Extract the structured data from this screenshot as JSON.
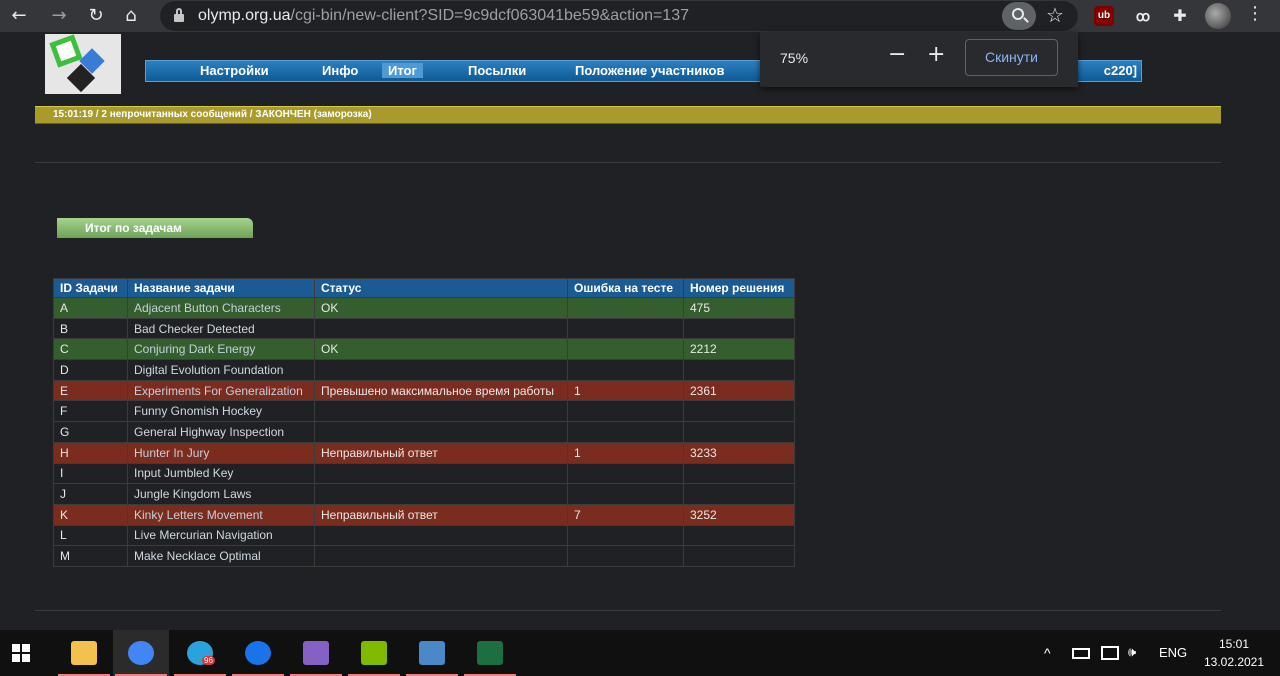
{
  "browser": {
    "url_host": "olymp.org.ua",
    "url_path": "/cgi-bin/new-client?SID=9c9dcf063041be59&action=137",
    "back_icon": "←",
    "forward_icon": "→",
    "reload_icon": "↻",
    "home_icon": "⌂",
    "star_icon": "☆",
    "puzzle_icon": "✚",
    "menu_icon": "⋮",
    "ext_ub": "ub",
    "ext_spy": "ꝏ"
  },
  "zoom_popup": {
    "level": "75%",
    "minus": "−",
    "plus": "+",
    "reset_label": "Скинути"
  },
  "nav": {
    "items": [
      "Настройки",
      "Инфо",
      "Итог",
      "Посылки",
      "Положение участников"
    ],
    "cutoff_text": "c220]"
  },
  "status": {
    "text": "15:01:19 / 2 непрочитанных сообщений / ЗАКОНЧЕН (заморозка)"
  },
  "section": {
    "title": "Итог по задачам"
  },
  "table": {
    "headers": [
      "ID Задачи",
      "Название задачи",
      "Статус",
      "Ошибка на тесте",
      "Номер решения"
    ],
    "rows": [
      {
        "id": "A",
        "name": "Adjacent Button Characters",
        "status": "OK",
        "test": "",
        "run": "475",
        "kind": "ok"
      },
      {
        "id": "B",
        "name": "Bad Checker Detected",
        "status": "",
        "test": "",
        "run": "",
        "kind": "plain"
      },
      {
        "id": "C",
        "name": "Conjuring Dark Energy",
        "status": "OK",
        "test": "",
        "run": "2212",
        "kind": "ok"
      },
      {
        "id": "D",
        "name": "Digital Evolution Foundation",
        "status": "",
        "test": "",
        "run": "",
        "kind": "plain"
      },
      {
        "id": "E",
        "name": "Experiments For Generalization",
        "status": "Превышено максимальное время работы",
        "test": "1",
        "run": "2361",
        "kind": "fail"
      },
      {
        "id": "F",
        "name": "Funny Gnomish Hockey",
        "status": "",
        "test": "",
        "run": "",
        "kind": "plain"
      },
      {
        "id": "G",
        "name": "General Highway Inspection",
        "status": "",
        "test": "",
        "run": "",
        "kind": "plain"
      },
      {
        "id": "H",
        "name": "Hunter In Jury",
        "status": "Неправильный ответ",
        "test": "1",
        "run": "3233",
        "kind": "fail"
      },
      {
        "id": "I",
        "name": "Input Jumbled Key",
        "status": "",
        "test": "",
        "run": "",
        "kind": "plain"
      },
      {
        "id": "J",
        "name": "Jungle Kingdom Laws",
        "status": "",
        "test": "",
        "run": "",
        "kind": "plain"
      },
      {
        "id": "K",
        "name": "Kinky Letters Movement",
        "status": "Неправильный ответ",
        "test": "7",
        "run": "3252",
        "kind": "fail"
      },
      {
        "id": "L",
        "name": "Live Mercurian Navigation",
        "status": "",
        "test": "",
        "run": "",
        "kind": "plain"
      },
      {
        "id": "M",
        "name": "Make Necklace Optimal",
        "status": "",
        "test": "",
        "run": "",
        "kind": "plain"
      }
    ]
  },
  "taskbar": {
    "apps": [
      {
        "name": "file-explorer",
        "color": "#f2c14e"
      },
      {
        "name": "chrome",
        "color": "#4285f4"
      },
      {
        "name": "telegram",
        "color": "#2aa3dd",
        "badge": "96"
      },
      {
        "name": "maps",
        "color": "#1a73e8"
      },
      {
        "name": "visual-studio",
        "color": "#8661c5"
      },
      {
        "name": "notepad",
        "color": "#7fba00"
      },
      {
        "name": "calculator",
        "color": "#4a88c7"
      },
      {
        "name": "excel",
        "color": "#1d6f42"
      }
    ],
    "tray_chevron": "^",
    "tray_lang": "ENG",
    "tray_volume": "🕪",
    "time": "15:01",
    "date": "13.02.2021"
  },
  "colors": {
    "ok_row": "#355e2e",
    "fail_row": "#7a2c1e",
    "header": "#1c5a94",
    "status_bar": "#a89a2c"
  }
}
